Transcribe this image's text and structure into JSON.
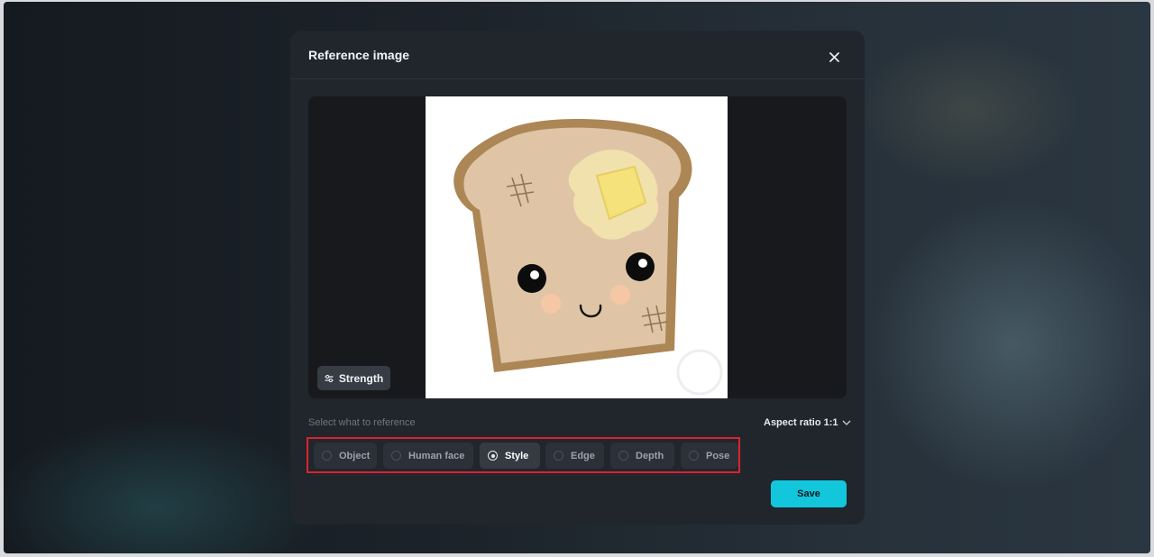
{
  "modal": {
    "title": "Reference image",
    "close_icon": "close-icon"
  },
  "preview": {
    "strength_label": "Strength",
    "strength_icon": "sliders-icon"
  },
  "reference": {
    "label": "Select what to reference",
    "aspect_ratio": "Aspect ratio 1:1",
    "options": [
      {
        "label": "Object",
        "selected": false
      },
      {
        "label": "Human face",
        "selected": false
      },
      {
        "label": "Style",
        "selected": true
      },
      {
        "label": "Edge",
        "selected": false
      },
      {
        "label": "Depth",
        "selected": false
      },
      {
        "label": "Pose",
        "selected": false
      }
    ]
  },
  "actions": {
    "save_label": "Save"
  },
  "colors": {
    "accent": "#12c7dc",
    "highlight_border": "#d9242e",
    "modal_bg": "#21252c"
  }
}
